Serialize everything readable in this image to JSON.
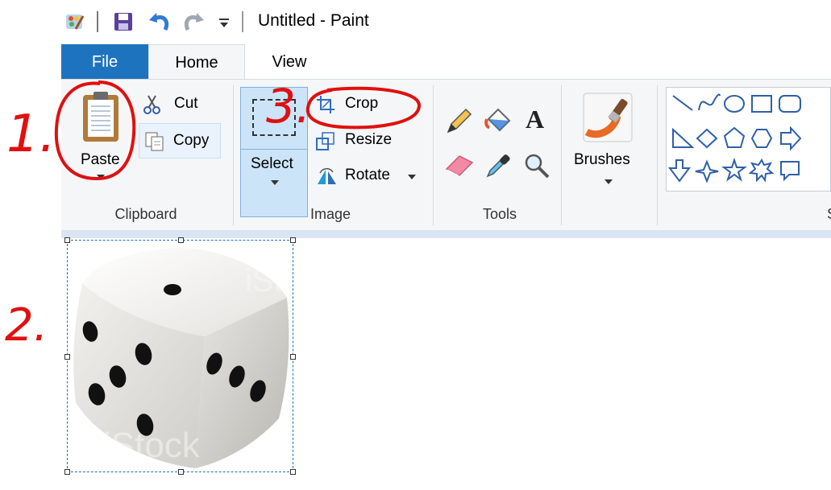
{
  "window": {
    "title": "Untitled - Paint"
  },
  "tabs": [
    {
      "label": "File"
    },
    {
      "label": "Home"
    },
    {
      "label": "View"
    }
  ],
  "clipboard": {
    "paste_label": "Paste",
    "cut_label": "Cut",
    "copy_label": "Copy",
    "group_label": "Clipboard"
  },
  "image": {
    "select_label": "Select",
    "crop_label": "Crop",
    "resize_label": "Resize",
    "rotate_label": "Rotate",
    "group_label": "Image"
  },
  "tools": {
    "group_label": "Tools"
  },
  "brushes": {
    "label": "Brushes"
  },
  "shapes": {
    "group_label_partial": "S"
  },
  "canvas": {
    "watermark": "iStock"
  },
  "annotations": {
    "step1": "1.",
    "step2": "2.",
    "step3": "3."
  },
  "colors": {
    "file_tab": "#1e73be",
    "ribbon_bg": "#f5f6f7",
    "selection_border": "#1e73be",
    "annotation_red": "#e01010"
  }
}
